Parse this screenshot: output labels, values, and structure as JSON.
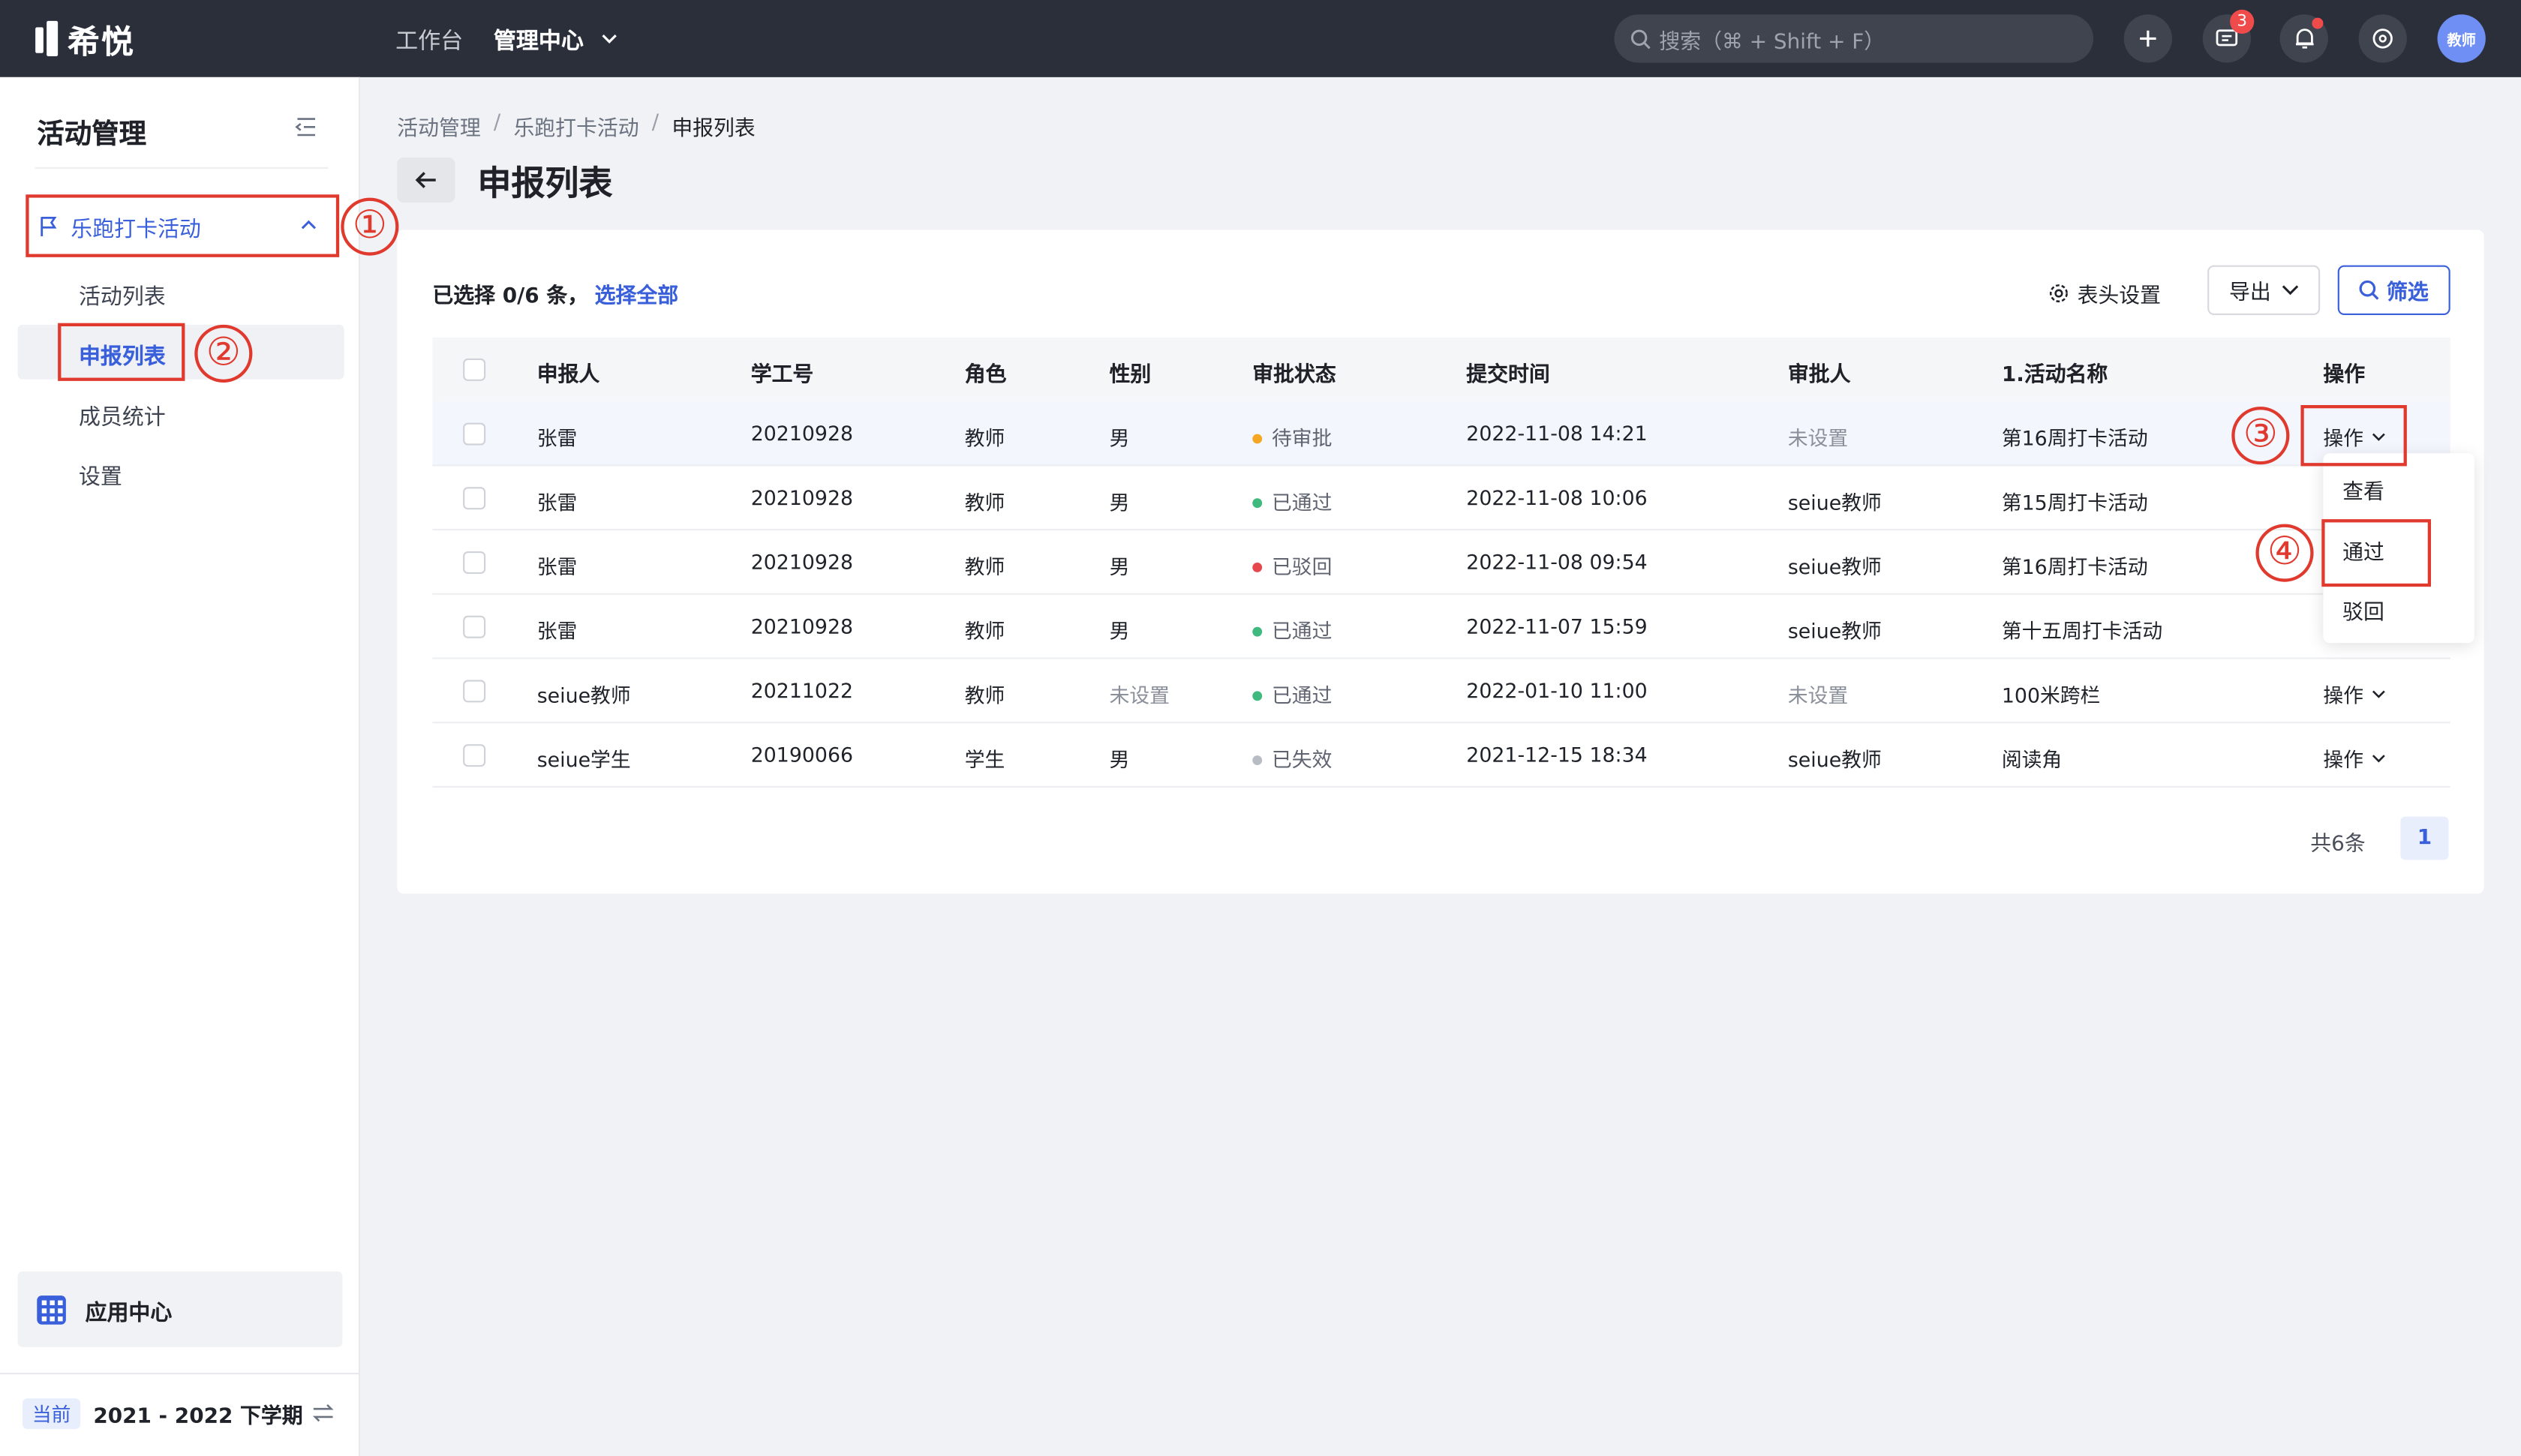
{
  "topbar": {
    "logo_text": "希悦",
    "nav": [
      "工作台",
      "管理中心"
    ],
    "search_placeholder": "搜索（⌘ + Shift + F）",
    "message_badge": "3",
    "avatar_text": "教师"
  },
  "sidebar": {
    "title": "活动管理",
    "group_label": "乐跑打卡活动",
    "items": [
      "活动列表",
      "申报列表",
      "成员统计",
      "设置"
    ],
    "active_item": "申报列表",
    "app_center": "应用中心",
    "term_tag": "当前",
    "term_label": "2021 - 2022 下学期"
  },
  "main": {
    "breadcrumb": [
      "活动管理",
      "乐跑打卡活动",
      "申报列表"
    ],
    "title": "申报列表",
    "selection_text": "已选择 0/6 条，",
    "select_all": "选择全部",
    "header_settings": "表头设置",
    "export": "导出",
    "filter": "筛选",
    "columns": [
      "申报人",
      "学工号",
      "角色",
      "性别",
      "审批状态",
      "提交时间",
      "审批人",
      "1.活动名称",
      "操作"
    ],
    "rows": [
      {
        "name": "张雷",
        "id": "20210928",
        "role": "教师",
        "gender": "男",
        "status": "待审批",
        "status_color": "#f5a623",
        "time": "2022-11-08 14:21",
        "approver": "未设置",
        "activity": "第16周打卡活动",
        "op": "操作"
      },
      {
        "name": "张雷",
        "id": "20210928",
        "role": "教师",
        "gender": "男",
        "status": "已通过",
        "status_color": "#3fb97e",
        "time": "2022-11-08 10:06",
        "approver": "seiue教师",
        "activity": "第15周打卡活动",
        "op": ""
      },
      {
        "name": "张雷",
        "id": "20210928",
        "role": "教师",
        "gender": "男",
        "status": "已驳回",
        "status_color": "#e5484d",
        "time": "2022-11-08 09:54",
        "approver": "seiue教师",
        "activity": "第16周打卡活动",
        "op": ""
      },
      {
        "name": "张雷",
        "id": "20210928",
        "role": "教师",
        "gender": "男",
        "status": "已通过",
        "status_color": "#3fb97e",
        "time": "2022-11-07 15:59",
        "approver": "seiue教师",
        "activity": "第十五周打卡活动",
        "op": ""
      },
      {
        "name": "seiue教师",
        "id": "20211022",
        "role": "教师",
        "gender": "未设置",
        "status": "已通过",
        "status_color": "#3fb97e",
        "time": "2022-01-10 11:00",
        "approver": "未设置",
        "activity": "100米跨栏",
        "op": "操作"
      },
      {
        "name": "seiue学生",
        "id": "20190066",
        "role": "学生",
        "gender": "男",
        "status": "已失效",
        "status_color": "#b8bcc4",
        "time": "2021-12-15 18:34",
        "approver": "seiue教师",
        "activity": "阅读角",
        "op": "操作"
      }
    ],
    "dropdown": [
      "查看",
      "通过",
      "驳回"
    ],
    "total": "共6条",
    "page": "1"
  },
  "annotations": [
    "①",
    "②",
    "③",
    "④"
  ],
  "colors": {
    "accent": "#3a5fdb",
    "topbar": "#2b2f3a",
    "annotation": "#e03a2f"
  }
}
